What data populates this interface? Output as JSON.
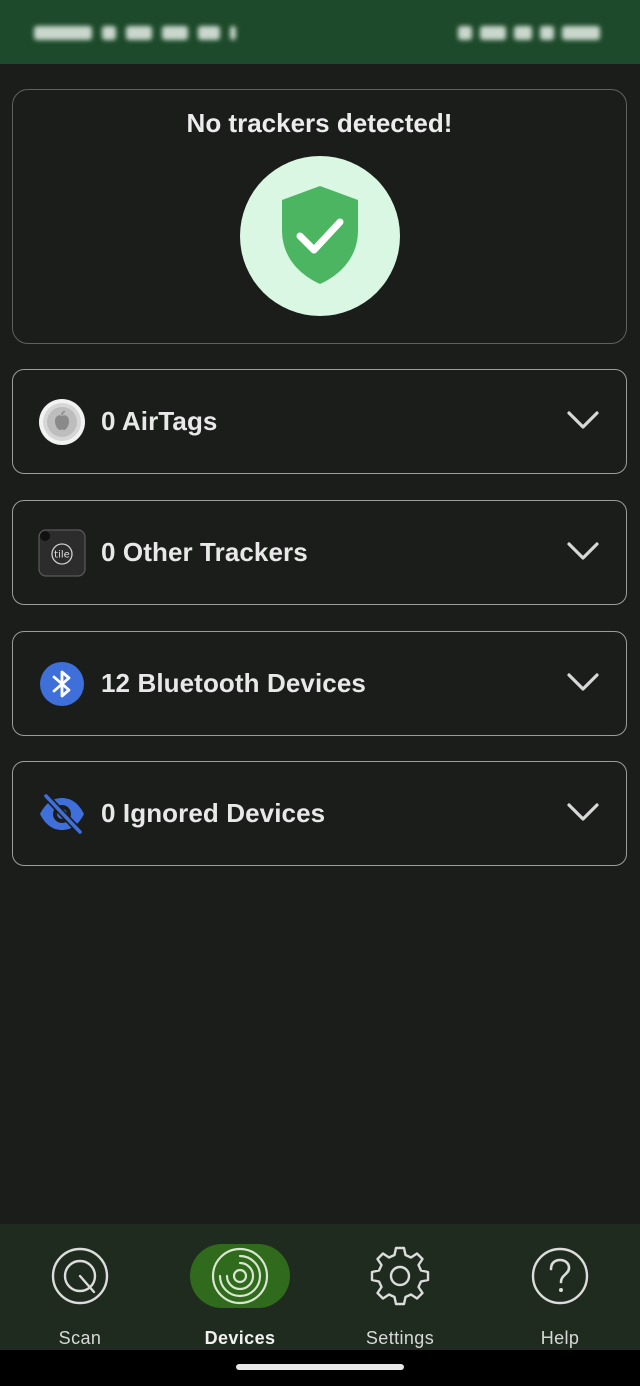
{
  "hero": {
    "title": "No trackers detected!",
    "status_color": "#4cb562",
    "circle_color": "#d9f7e3"
  },
  "sections": [
    {
      "icon": "airtag-icon",
      "label": "0 AirTags"
    },
    {
      "icon": "tile-tracker-icon",
      "label": "0 Other Trackers"
    },
    {
      "icon": "bluetooth-icon",
      "label": "12 Bluetooth Devices"
    },
    {
      "icon": "eye-off-icon",
      "label": "0 Ignored Devices"
    }
  ],
  "nav": {
    "items": [
      {
        "icon": "scan-icon",
        "label": "Scan",
        "active": false
      },
      {
        "icon": "devices-radar-icon",
        "label": "Devices",
        "active": true
      },
      {
        "icon": "gear-icon",
        "label": "Settings",
        "active": false
      },
      {
        "icon": "help-icon",
        "label": "Help",
        "active": false
      }
    ],
    "active_color": "#2f6a1d"
  },
  "colors": {
    "background": "#1b1d1b",
    "status_bar": "#1d4a2a",
    "nav_background": "#1f2b1e",
    "accent_blue": "#3f6fd8"
  }
}
